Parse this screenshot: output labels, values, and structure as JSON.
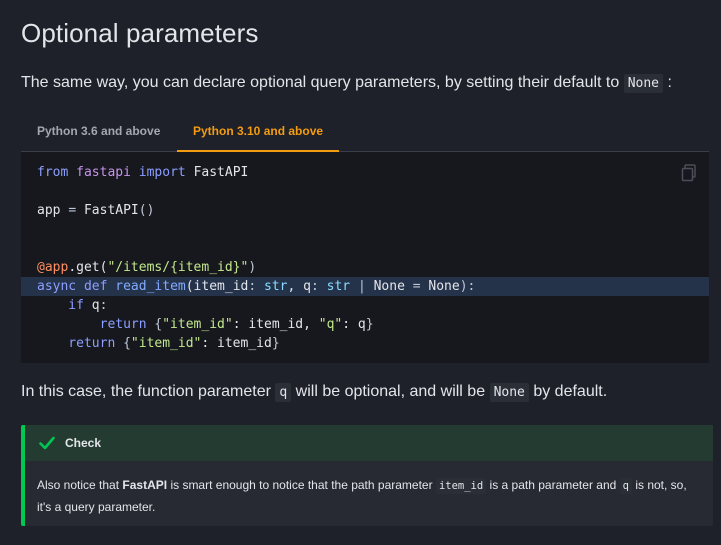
{
  "heading": "Optional parameters",
  "lead": {
    "text": "The same way, you can declare optional query parameters, by setting their default to",
    "code": "None",
    "suffix": ":"
  },
  "tabs": [
    {
      "label": "Python 3.6 and above",
      "active": false
    },
    {
      "label": "Python 3.10 and above",
      "active": true
    }
  ],
  "code": {
    "lines": [
      [
        {
          "t": "from ",
          "c": "kw"
        },
        {
          "t": "fastapi ",
          "c": "mod"
        },
        {
          "t": "import ",
          "c": "kw"
        },
        {
          "t": "FastAPI",
          "c": "plain"
        }
      ],
      [],
      [
        {
          "t": "app ",
          "c": "plain"
        },
        {
          "t": "= ",
          "c": "op"
        },
        {
          "t": "FastAPI",
          "c": "plain"
        },
        {
          "t": "()",
          "c": "op"
        }
      ],
      [],
      [],
      [
        {
          "t": "@app",
          "c": "dec"
        },
        {
          "t": ".get(",
          "c": "plain"
        },
        {
          "t": "\"/items/{item_id}\"",
          "c": "str"
        },
        {
          "t": ")",
          "c": "op"
        }
      ],
      [
        {
          "t": "async ",
          "c": "kw"
        },
        {
          "t": "def ",
          "c": "kw"
        },
        {
          "t": "read_item",
          "c": "fn"
        },
        {
          "t": "(item_id",
          "c": "plain"
        },
        {
          "t": ": ",
          "c": "op"
        },
        {
          "t": "str",
          "c": "ty"
        },
        {
          "t": ", q",
          "c": "plain"
        },
        {
          "t": ": ",
          "c": "op"
        },
        {
          "t": "str ",
          "c": "ty"
        },
        {
          "t": "| ",
          "c": "op"
        },
        {
          "t": "None ",
          "c": "plain"
        },
        {
          "t": "= ",
          "c": "op"
        },
        {
          "t": "None",
          "c": "plain"
        },
        {
          "t": "):",
          "c": "op"
        }
      ],
      [
        {
          "t": "    if ",
          "c": "kw"
        },
        {
          "t": "q",
          "c": "plain"
        },
        {
          "t": ":",
          "c": "op"
        }
      ],
      [
        {
          "t": "        return ",
          "c": "kw"
        },
        {
          "t": "{",
          "c": "op"
        },
        {
          "t": "\"item_id\"",
          "c": "str"
        },
        {
          "t": ": item_id, ",
          "c": "plain"
        },
        {
          "t": "\"q\"",
          "c": "str"
        },
        {
          "t": ": q",
          "c": "plain"
        },
        {
          "t": "}",
          "c": "op"
        }
      ],
      [
        {
          "t": "    return ",
          "c": "kw"
        },
        {
          "t": "{",
          "c": "op"
        },
        {
          "t": "\"item_id\"",
          "c": "str"
        },
        {
          "t": ": item_id",
          "c": "plain"
        },
        {
          "t": "}",
          "c": "op"
        }
      ]
    ],
    "highlighted_line": 6
  },
  "para2": {
    "before": "In this case, the function parameter",
    "code1": "q",
    "middle": "will be optional, and will be",
    "code2": "None",
    "after": "by default."
  },
  "admonition": {
    "title": "Check",
    "body_before": "Also notice that",
    "body_bold": "FastAPI",
    "body_mid": "is smart enough to notice that the path parameter",
    "body_code1": "item_id",
    "body_mid2": "is a path parameter and",
    "body_code2": "q",
    "body_after": "is not, so, it's a query parameter."
  },
  "colors": {
    "accent": "#f39c12",
    "success": "#00c853"
  },
  "icons": {
    "copy": "copy-icon",
    "check": "check-icon"
  }
}
